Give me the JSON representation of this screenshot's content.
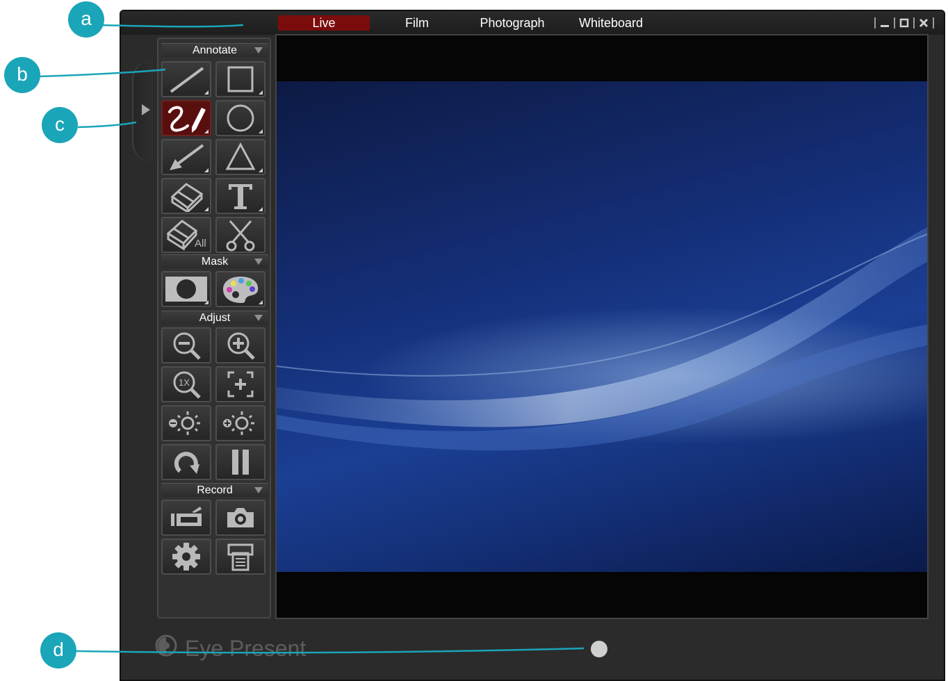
{
  "window": {
    "tabs": [
      {
        "label": "Live",
        "active": true
      },
      {
        "label": "Film",
        "active": false
      },
      {
        "label": "Photograph",
        "active": false
      },
      {
        "label": "Whiteboard",
        "active": false
      }
    ],
    "controls": [
      "minimize-icon",
      "maximize-icon",
      "close-icon"
    ]
  },
  "sections": {
    "annotate": "Annotate",
    "mask": "Mask",
    "adjust": "Adjust",
    "record": "Record"
  },
  "tools": {
    "erase_all_label": "All",
    "annotate": [
      "line-icon",
      "rectangle-icon",
      "freehand-pen-icon",
      "circle-icon",
      "arrow-icon",
      "triangle-icon",
      "eraser-icon",
      "text-icon",
      "erase-all-icon",
      "scissors-icon"
    ],
    "mask": [
      "mask-icon",
      "palette-icon"
    ],
    "adjust": [
      "zoom-out-icon",
      "zoom-in-icon",
      "zoom-1x-icon",
      "fit-screen-icon",
      "brightness-down-icon",
      "brightness-up-icon",
      "rotate-icon",
      "pause-icon"
    ],
    "record": [
      "video-camera-icon",
      "camera-icon",
      "settings-gear-icon",
      "print-icon"
    ]
  },
  "footer": {
    "logo_text": "Eye Present"
  },
  "callouts": [
    "a",
    "b",
    "c",
    "d"
  ],
  "colors": {
    "accent": "#7a0c0c",
    "callout": "#1aa5b8",
    "selected_tool": "#5a0f0f"
  }
}
